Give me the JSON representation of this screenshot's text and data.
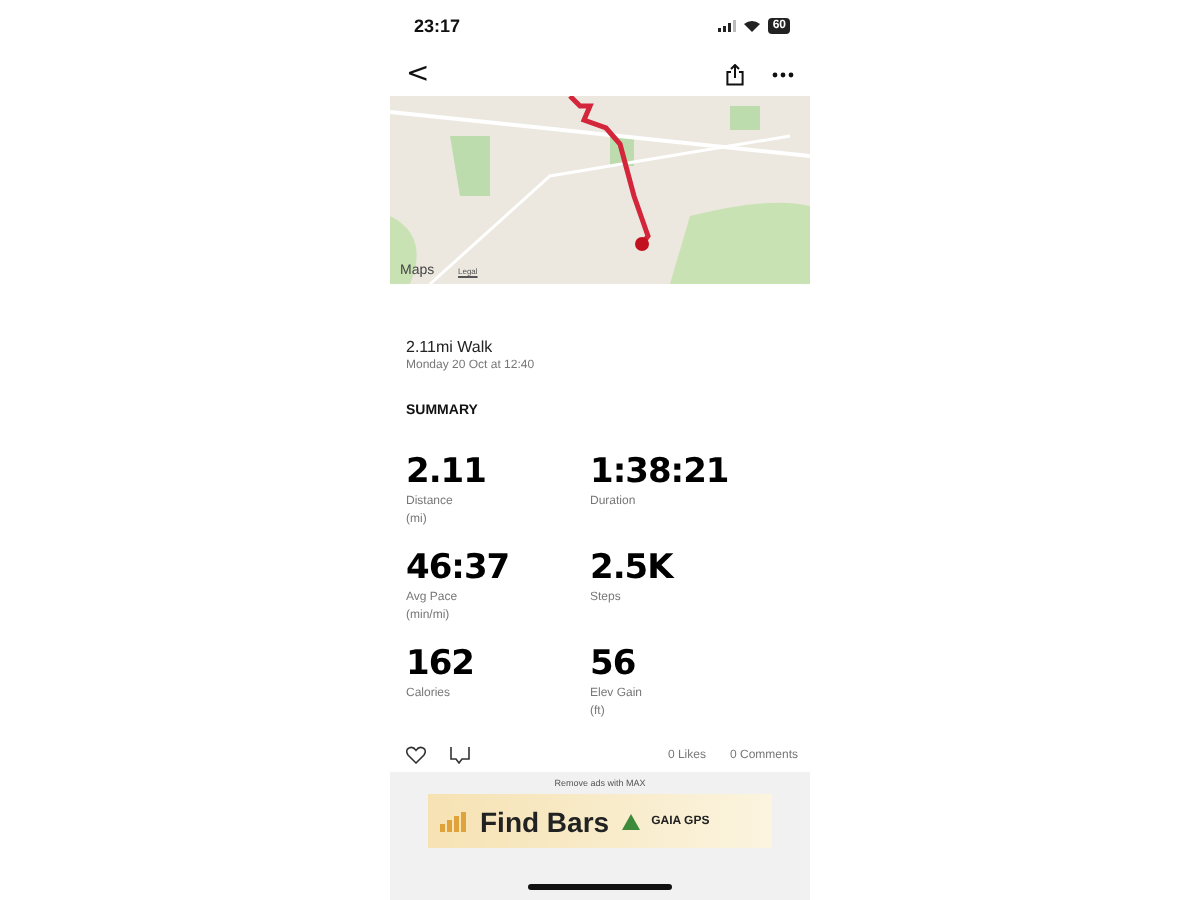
{
  "status_bar": {
    "time": "23:17",
    "battery": "60"
  },
  "nav": {
    "back": "<"
  },
  "map": {
    "attribution": "Maps",
    "legal": "Legal"
  },
  "activity": {
    "title": "2.11mi Walk",
    "date": "Monday 20 Oct at 12:40"
  },
  "summary": {
    "heading": "SUMMARY",
    "stats": [
      {
        "value": "2.11",
        "label": "Distance",
        "unit": "(mi)"
      },
      {
        "value": "1:38:21",
        "label": "Duration"
      },
      {
        "value": "46:37",
        "label": "Avg Pace",
        "unit": "(min/mi)"
      },
      {
        "value": "2.5K",
        "label": "Steps"
      },
      {
        "value": "162",
        "label": "Calories"
      },
      {
        "value": "56",
        "label": "Elev Gain",
        "unit": "(ft)"
      }
    ]
  },
  "social": {
    "likes": "0 Likes",
    "comments": "0 Comments"
  },
  "ad": {
    "notice": "Remove ads with MAX",
    "headline": "Find Bars",
    "brand": "GAIA GPS"
  }
}
